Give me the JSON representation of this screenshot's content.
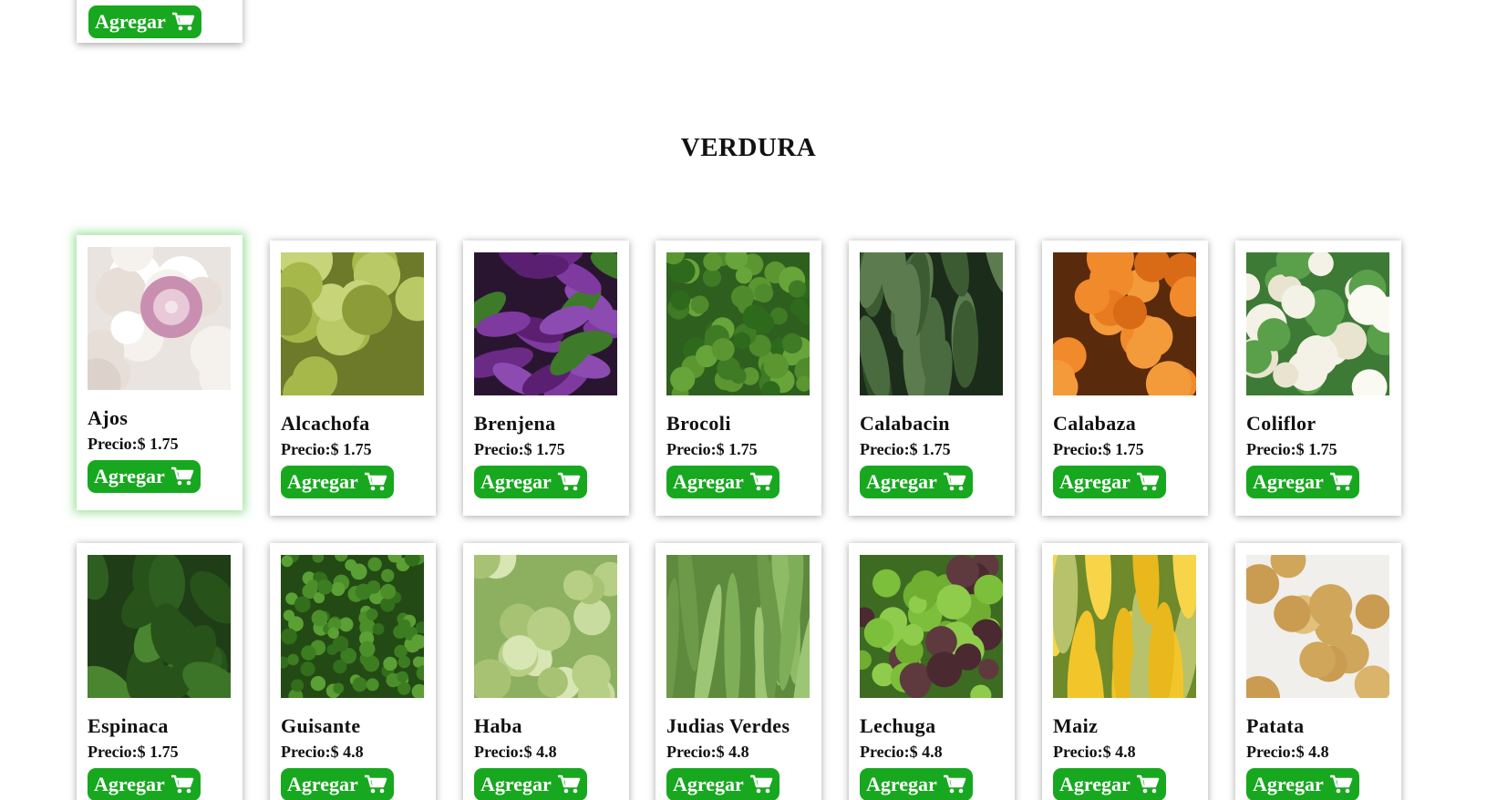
{
  "top_card": {
    "button_label": "Agregar"
  },
  "section": {
    "title": "VERDURA"
  },
  "products_row1": [
    {
      "name": "Ajos",
      "price": "Precio:$ 1.75",
      "button_label": "Agregar",
      "image": "garlic",
      "highlighted": true
    },
    {
      "name": "Alcachofa",
      "price": "Precio:$ 1.75",
      "button_label": "Agregar",
      "image": "artichoke"
    },
    {
      "name": "Brenjena",
      "price": "Precio:$ 1.75",
      "button_label": "Agregar",
      "image": "eggplant"
    },
    {
      "name": "Brocoli",
      "price": "Precio:$ 1.75",
      "button_label": "Agregar",
      "image": "broccoli"
    },
    {
      "name": "Calabacin",
      "price": "Precio:$ 1.75",
      "button_label": "Agregar",
      "image": "zucchini"
    },
    {
      "name": "Calabaza",
      "price": "Precio:$ 1.75",
      "button_label": "Agregar",
      "image": "pumpkin"
    },
    {
      "name": "Coliflor",
      "price": "Precio:$ 1.75",
      "button_label": "Agregar",
      "image": "cauliflower"
    }
  ],
  "products_row2": [
    {
      "name": "Espinaca",
      "price": "Precio:$ 1.75",
      "button_label": "Agregar",
      "image": "spinach"
    },
    {
      "name": "Guisante",
      "price": "Precio:$ 4.8",
      "button_label": "Agregar",
      "image": "peas"
    },
    {
      "name": "Haba",
      "price": "Precio:$ 4.8",
      "button_label": "Agregar",
      "image": "broad-beans"
    },
    {
      "name": "Judias Verdes",
      "price": "Precio:$ 4.8",
      "button_label": "Agregar",
      "image": "green-beans"
    },
    {
      "name": "Lechuga",
      "price": "Precio:$ 4.8",
      "button_label": "Agregar",
      "image": "lettuce"
    },
    {
      "name": "Maiz",
      "price": "Precio:$ 4.8",
      "button_label": "Agregar",
      "image": "corn"
    },
    {
      "name": "Patata",
      "price": "Precio:$ 4.8",
      "button_label": "Agregar",
      "image": "potato"
    }
  ],
  "colors": {
    "button": "#17a81f",
    "highlight_glow": "#50c850"
  }
}
